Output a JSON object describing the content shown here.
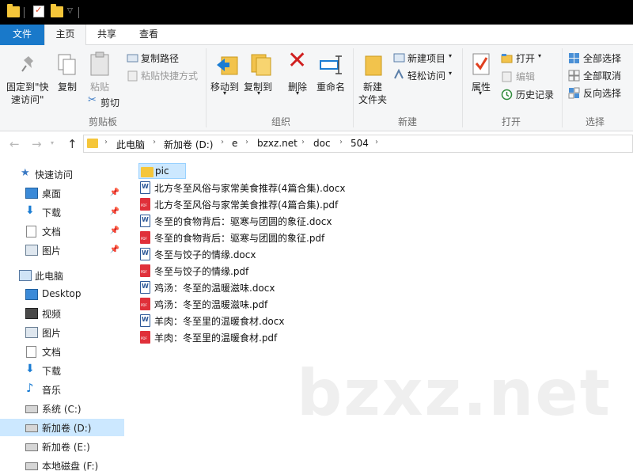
{
  "ribbon_tabs": {
    "file": "文件",
    "home": "主页",
    "share": "共享",
    "view": "查看"
  },
  "clipboard": {
    "pin": "固定到\"快",
    "pin2": "速访问\"",
    "copy": "复制",
    "paste": "粘贴",
    "copy_path": "复制路径",
    "paste_shortcut": "粘贴快捷方式",
    "cut": "剪切",
    "label": "剪贴板"
  },
  "organize": {
    "move_to": "移动到",
    "copy_to": "复制到",
    "delete": "删除",
    "rename": "重命名",
    "label": "组织"
  },
  "new_group": {
    "new_folder": "新建",
    "new_folder2": "文件夹",
    "new_item": "新建项目",
    "easy_access": "轻松访问",
    "label": "新建"
  },
  "open_group": {
    "properties": "属性",
    "open": "打开",
    "edit": "编辑",
    "history": "历史记录",
    "label": "打开"
  },
  "select_group": {
    "select_all": "全部选择",
    "select_none": "全部取消",
    "invert": "反向选择",
    "label": "选择"
  },
  "breadcrumb": [
    "此电脑",
    "新加卷 (D:)",
    "e",
    "bzxz.net",
    "doc",
    "504"
  ],
  "nav": {
    "quick_access": "快速访问",
    "quick_items": [
      "桌面",
      "下载",
      "文档",
      "图片"
    ],
    "this_pc": "此电脑",
    "pc_items": [
      "Desktop",
      "视频",
      "图片",
      "文档",
      "下载",
      "音乐"
    ],
    "drives": [
      "系统 (C:)",
      "新加卷 (D:)",
      "新加卷 (E:)",
      "本地磁盘 (F:)"
    ]
  },
  "files": [
    {
      "name": "pic",
      "type": "folder"
    },
    {
      "name": "北方冬至风俗与家常美食推荐(4篇合集).docx",
      "type": "docx"
    },
    {
      "name": "北方冬至风俗与家常美食推荐(4篇合集).pdf",
      "type": "pdf"
    },
    {
      "name": "冬至的食物背后：驱寒与团圆的象征.docx",
      "type": "docx"
    },
    {
      "name": "冬至的食物背后：驱寒与团圆的象征.pdf",
      "type": "pdf"
    },
    {
      "name": "冬至与饺子的情缘.docx",
      "type": "docx"
    },
    {
      "name": "冬至与饺子的情缘.pdf",
      "type": "pdf"
    },
    {
      "name": "鸡汤：冬至的温暖滋味.docx",
      "type": "docx"
    },
    {
      "name": "鸡汤：冬至的温暖滋味.pdf",
      "type": "pdf"
    },
    {
      "name": "羊肉：冬至里的温暖食材.docx",
      "type": "docx"
    },
    {
      "name": "羊肉：冬至里的温暖食材.pdf",
      "type": "pdf"
    }
  ],
  "watermark": "bzxz.net",
  "colors": {
    "accent": "#1979ca",
    "selection": "#cce8ff",
    "folder": "#f5c63a",
    "pdf": "#e0303a",
    "word": "#2b5797"
  }
}
